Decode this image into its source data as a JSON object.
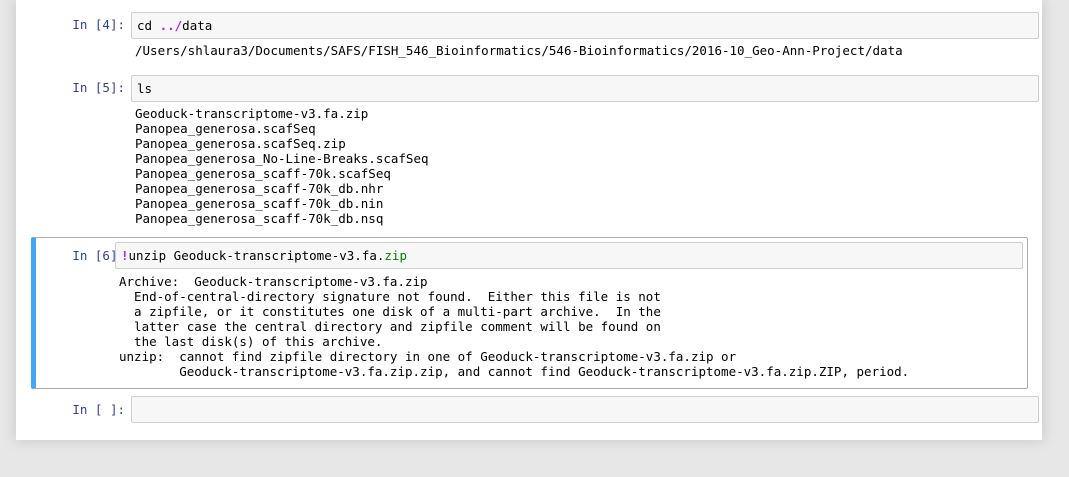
{
  "cells": [
    {
      "prompt": "In [4]:",
      "code": {
        "keyword": "cd",
        "op": "../",
        "rest": "data"
      },
      "output": [
        "/Users/shlaura3/Documents/SAFS/FISH_546_Bioinformatics/546-Bioinformatics/2016-10_Geo-Ann-Project/data"
      ]
    },
    {
      "prompt": "In [5]:",
      "code": {
        "text": "ls"
      },
      "output": [
        "Geoduck-transcriptome-v3.fa.zip",
        "Panopea_generosa.scafSeq",
        "Panopea_generosa.scafSeq.zip",
        "Panopea_generosa_No-Line-Breaks.scafSeq",
        "Panopea_generosa_scaff-70k.scafSeq",
        "Panopea_generosa_scaff-70k_db.nhr",
        "Panopea_generosa_scaff-70k_db.nin",
        "Panopea_generosa_scaff-70k_db.nsq"
      ]
    },
    {
      "prompt": "In [6]:",
      "code": {
        "bang": "!",
        "main": "unzip Geoduck-transcriptome-v3.fa.",
        "ext": "zip"
      },
      "output": [
        "Archive:  Geoduck-transcriptome-v3.fa.zip",
        "  End-of-central-directory signature not found.  Either this file is not",
        "  a zipfile, or it constitutes one disk of a multi-part archive.  In the",
        "  latter case the central directory and zipfile comment will be found on",
        "  the last disk(s) of this archive.",
        "unzip:  cannot find zipfile directory in one of Geoduck-transcriptome-v3.fa.zip or",
        "        Geoduck-transcriptome-v3.fa.zip.zip, and cannot find Geoduck-transcriptome-v3.fa.zip.ZIP, period."
      ],
      "selected": true
    },
    {
      "prompt": "In [ ]:",
      "code": {
        "text": ""
      }
    }
  ],
  "colors": {
    "prompt": "#303f9f",
    "selected_border": "#42a5f5",
    "input_bg": "#f7f7f7",
    "page_bg": "#e7e7e7"
  }
}
